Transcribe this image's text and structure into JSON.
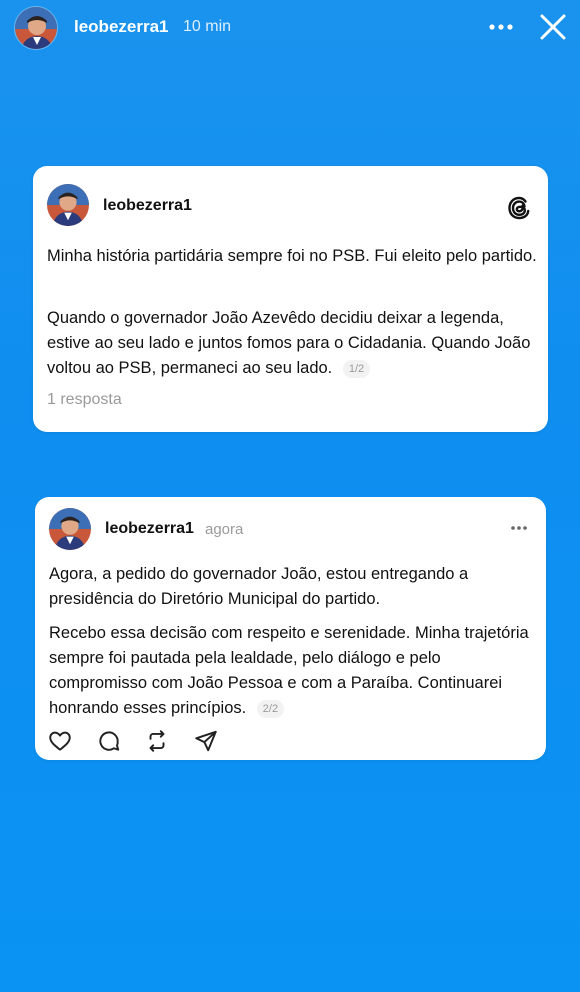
{
  "story": {
    "username": "leobezerra1",
    "time": "10 min",
    "icons": {
      "more": "more-horizontal-icon",
      "close": "close-icon"
    }
  },
  "posts": [
    {
      "username": "leobezerra1",
      "paragraphs": [
        "Minha história partidária sempre foi no PSB. Fui eleito pelo partido.",
        "Quando o governador João Azevêdo decidiu deixar a legenda, estive ao seu lado e juntos fomos para o Cidadania. Quando João voltou ao PSB, permaneci ao seu lado."
      ],
      "pager": "1/2",
      "replies": "1 resposta",
      "badge_icon": "threads-logo-icon"
    },
    {
      "username": "leobezerra1",
      "time": "agora",
      "paragraphs": [
        "Agora, a pedido do governador João, estou entregando a presidência do Diretório Municipal do partido.",
        "Recebo essa decisão com respeito e serenidade. Minha trajetória sempre foi pautada pela lealdade, pelo diálogo e pelo compromisso com João Pessoa e com a Paraíba. Continuarei honrando esses princípios."
      ],
      "pager": "2/2",
      "actions": [
        "heart-icon",
        "comment-icon",
        "repost-icon",
        "share-icon"
      ]
    }
  ],
  "colors": {
    "background": "#1190f0",
    "card": "#ffffff",
    "muted": "#9a9a9a"
  }
}
